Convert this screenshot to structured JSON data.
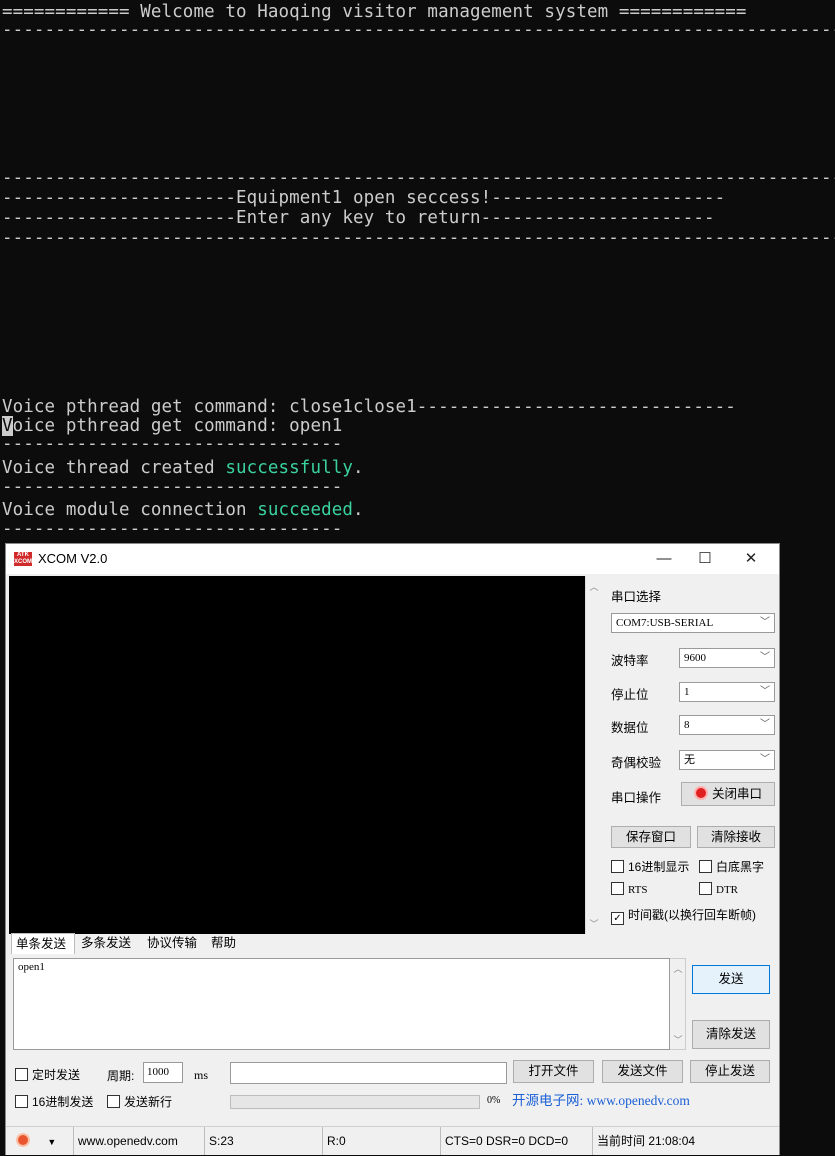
{
  "terminal": {
    "lines": [
      "============ Welcome to Haoqing visitor management system ============",
      "------------------------------------------------------------------------------------------",
      "------------------------------------------------------------------------------------------",
      "----------------------Equipment1 open seccess!----------------------",
      "----------------------Enter any key to return----------------------",
      "------------------------------------------------------------------------------------------",
      "Voice pthread get command: close1close1------------------------------",
      "oice pthread get command: open1",
      "--------------------------------",
      "Voice thread created ",
      "successfully",
      ".",
      "--------------------------------",
      "Voice module connection ",
      "succeeded",
      ".",
      "--------------------------------",
      "V"
    ]
  },
  "xcom": {
    "title": "XCOM V2.0",
    "logo_text": "ATK XCOM",
    "win_controls": {
      "minimize": "—",
      "maximize": "☐",
      "close": "✕"
    },
    "side": {
      "port_select_label": "串口选择",
      "port_value": "COM7:USB-SERIAL",
      "baud_label": "波特率",
      "baud_value": "9600",
      "stopbit_label": "停止位",
      "stopbit_value": "1",
      "databit_label": "数据位",
      "databit_value": "8",
      "parity_label": "奇偶校验",
      "parity_value": "无",
      "port_op_label": "串口操作",
      "close_port_button": "关闭串口",
      "save_window_button": "保存窗口",
      "clear_recv_button": "清除接收",
      "hex_display": "16进制显示",
      "white_bg": "白底黑字",
      "rts": "RTS",
      "dtr": "DTR",
      "timestamp": "时间戳(以换行回车断帧)"
    },
    "tabs": [
      "单条发送",
      "多条发送",
      "协议传输",
      "帮助"
    ],
    "send_text": "open1",
    "send_button": "发送",
    "clear_send_button": "清除发送",
    "timed_send": "定时发送",
    "period_label": "周期:",
    "period_value": "1000",
    "period_unit": "ms",
    "open_file_button": "打开文件",
    "send_file_button": "发送文件",
    "stop_send_button": "停止发送",
    "hex_send": "16进制发送",
    "send_newline": "发送新行",
    "progress_percent": "0%",
    "progress_value": 0,
    "site_banner": "开源电子网: www.openedv.com",
    "status": {
      "url": "www.openedv.com",
      "sent": "S:23",
      "recv": "R:0",
      "lines": "CTS=0 DSR=0 DCD=0",
      "time": "当前时间 21:08:04"
    },
    "colors": {
      "accent_green": "#16c60c",
      "close_port_red": "#e02020",
      "site_blue": "#1a5fd6"
    }
  }
}
